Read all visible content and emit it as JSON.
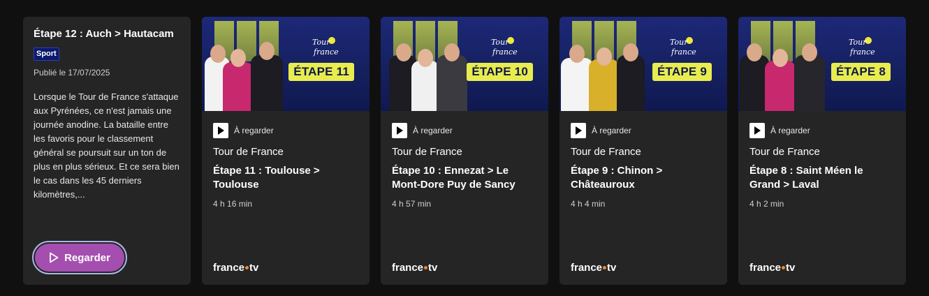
{
  "featured": {
    "title": "Étape 12 : Auch > Hautacam",
    "badge": "Sport",
    "published": "Publié le 17/07/2025",
    "description": "Lorsque le Tour de France s'attaque aux Pyrénées, ce n'est jamais une journée anodine. La bataille entre les favoris pour le classement général se poursuit sur un ton de plus en plus sérieux. Et ce sera bien le cas dans les 45 derniers kilomètres,...",
    "watch_label": "Regarder",
    "button_color": "#a44fb0"
  },
  "cards": [
    {
      "etape_tag": "ÉTAPE 11",
      "play_label": "À regarder",
      "program": "Tour de France",
      "title": "Étape 11 : Toulouse > Toulouse",
      "duration": "4 h 16 min",
      "brand_left": "france",
      "brand_right": "tv"
    },
    {
      "etape_tag": "ÉTAPE 10",
      "play_label": "À regarder",
      "program": "Tour de France",
      "title": "Étape 10 : Ennezat > Le Mont-Dore Puy de Sancy",
      "duration": "4 h 57 min",
      "brand_left": "france",
      "brand_right": "tv"
    },
    {
      "etape_tag": "ÉTAPE 9",
      "play_label": "À regarder",
      "program": "Tour de France",
      "title": "Étape 9 : Chinon > Châteauroux",
      "duration": "4 h 4 min",
      "brand_left": "france",
      "brand_right": "tv"
    },
    {
      "etape_tag": "ÉTAPE 8",
      "play_label": "À regarder",
      "program": "Tour de France",
      "title": "Étape 8 : Saint Méen le Grand > Laval",
      "duration": "4 h 2 min",
      "brand_left": "france",
      "brand_right": "tv"
    }
  ],
  "colors": {
    "background": "#101010",
    "card": "#252525",
    "etape_tag": "#e8ec4f",
    "thumb_navy": "#1d2878",
    "brand_dot": "#f08a2c"
  }
}
